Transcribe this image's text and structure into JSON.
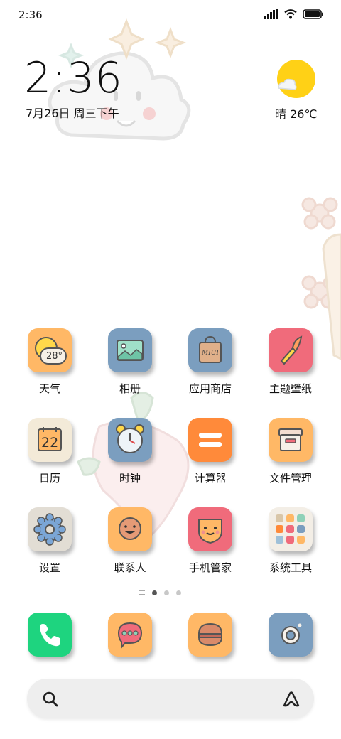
{
  "status_bar": {
    "time": "2:36"
  },
  "clock_widget": {
    "time": "2:36",
    "date": "7月26日 周三下午"
  },
  "weather_widget": {
    "text": "晴 26℃"
  },
  "apps": [
    {
      "label": "天气",
      "icon": "weather-icon"
    },
    {
      "label": "相册",
      "icon": "gallery-icon"
    },
    {
      "label": "应用商店",
      "icon": "app-store-icon"
    },
    {
      "label": "主题壁纸",
      "icon": "themes-icon"
    },
    {
      "label": "日历",
      "icon": "calendar-icon"
    },
    {
      "label": "时钟",
      "icon": "alarm-clock-icon"
    },
    {
      "label": "计算器",
      "icon": "calculator-icon"
    },
    {
      "label": "文件管理",
      "icon": "file-manager-icon"
    },
    {
      "label": "设置",
      "icon": "settings-gear-icon"
    },
    {
      "label": "联系人",
      "icon": "contacts-icon"
    },
    {
      "label": "手机管家",
      "icon": "security-icon"
    },
    {
      "label": "系统工具",
      "icon": "folder-grid-icon"
    }
  ],
  "icon_text": {
    "weather_temp": "28°",
    "calendar_day": "22",
    "store_brand": "MIUI"
  },
  "dock": [
    {
      "icon": "phone-icon"
    },
    {
      "icon": "messages-icon"
    },
    {
      "icon": "browser-icon"
    },
    {
      "icon": "camera-icon"
    }
  ],
  "page_indicator": {
    "pages": 3,
    "current": 1
  },
  "colors": {
    "orange": "#ffb866",
    "blue": "#7b9ebf",
    "pink": "#f06b7b",
    "green": "#1ed47f",
    "yellow": "#ffd116"
  }
}
